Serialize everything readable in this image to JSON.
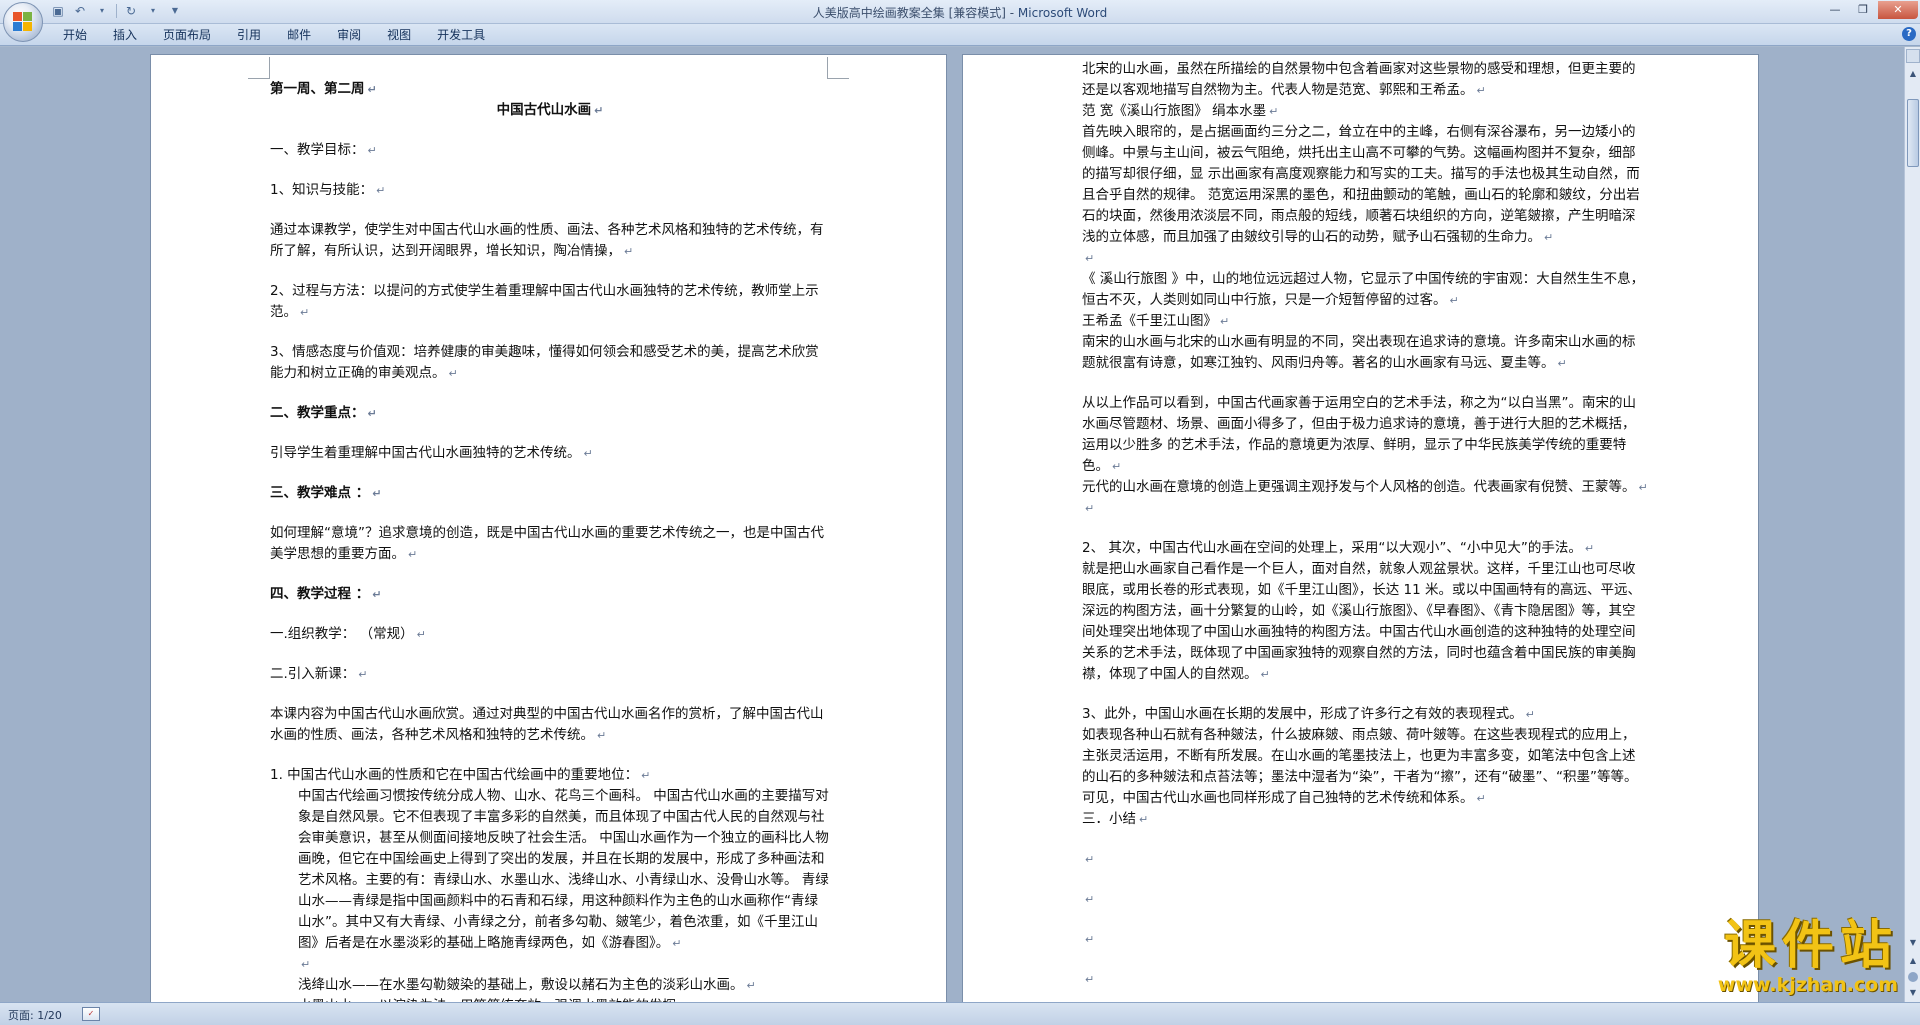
{
  "window": {
    "title_doc": "人美版高中绘画教案全集 [兼容模式] - ",
    "title_app": "Microsoft Word"
  },
  "ribbon": {
    "tabs": [
      "开始",
      "插入",
      "页面布局",
      "引用",
      "邮件",
      "审阅",
      "视图",
      "开发工具"
    ]
  },
  "status": {
    "page": "页面: 1/20"
  },
  "watermark": {
    "logo": "课件站",
    "url": "www.kjzhan.com"
  },
  "colors": {
    "accent": "#2a6ac4",
    "watermark": "#f2c315"
  },
  "left_page": [
    {
      "t": "第一周、第二周",
      "s": "b"
    },
    {
      "t": "中国古代山水画",
      "s": "b center"
    },
    {
      "t": "",
      "s": "gap"
    },
    {
      "t": "一、教学目标：",
      "s": ""
    },
    {
      "t": "",
      "s": "gap"
    },
    {
      "t": "1、知识与技能：",
      "s": ""
    },
    {
      "t": "",
      "s": "gap"
    },
    {
      "t": "通过本课教学，使学生对中国古代山水画的性质、画法、各种艺术风格和独特的艺术传统，有所了解，有所认识，达到开阔眼界，增长知识，陶冶情操，",
      "s": ""
    },
    {
      "t": "",
      "s": "gap"
    },
    {
      "t": "2、过程与方法：以提问的方式使学生着重理解中国古代山水画独特的艺术传统，教师堂上示范。",
      "s": ""
    },
    {
      "t": "",
      "s": "gap"
    },
    {
      "t": "3、情感态度与价值观：培养健康的审美趣味，懂得如何领会和感受艺术的美，提高艺术欣赏能力和树立正确的审美观点。",
      "s": ""
    },
    {
      "t": "",
      "s": "gap"
    },
    {
      "t": "二、教学重点：",
      "s": "b"
    },
    {
      "t": "",
      "s": "gap"
    },
    {
      "t": "引导学生着重理解中国古代山水画独特的艺术传统。",
      "s": ""
    },
    {
      "t": "",
      "s": "gap"
    },
    {
      "t": "三、教学难点 ：",
      "s": "b"
    },
    {
      "t": "",
      "s": "gap"
    },
    {
      "t": "如何理解“意境”？追求意境的创造，既是中国古代山水画的重要艺术传统之一，也是中国古代美学思想的重要方面。",
      "s": ""
    },
    {
      "t": "",
      "s": "gap"
    },
    {
      "t": "四、教学过程 ：",
      "s": "b"
    },
    {
      "t": "",
      "s": "gap"
    },
    {
      "t": "一.组织教学：  （常规）",
      "s": ""
    },
    {
      "t": "",
      "s": "gap"
    },
    {
      "t": "二.引入新课：",
      "s": ""
    },
    {
      "t": "",
      "s": "gap"
    },
    {
      "t": "本课内容为中国古代山水画欣赏。通过对典型的中国古代山水画名作的赏析，了解中国古代山水画的性质、画法，各种艺术风格和独特的艺术传统。",
      "s": ""
    },
    {
      "t": "",
      "s": "gap"
    },
    {
      "t": "1.  中国古代山水画的性质和它在中国古代绘画中的重要地位：",
      "s": ""
    },
    {
      "t": "中国古代绘画习惯按传统分成人物、山水、花鸟三个画科。 中国古代山水画的主要描写对象是自然风景。它不但表现了丰富多彩的自然美，而且体现了中国古代人民的自然观与社会审美意识，甚至从侧面间接地反映了社会生活。 中国山水画作为一个独立的画科比人物画晚，但它在中国绘画史上得到了突出的发展，并且在长期的发展中，形成了多种画法和艺术风格。主要的有：青绿山水、水墨山水、浅绛山水、小青绿山水、没骨山水等。 青绿山水——青绿是指中国画颜料中的石青和石绿，用这种颜料作为主色的山水画称作“青绿山水”。其中又有大青绿、小青绿之分，前者多勾勒、皴笔少，着色浓重，如《千里江山图》后者是在水墨淡彩的基础上略施青绿两色，如《游春图》。",
      "s": "indent"
    },
    {
      "t": "",
      "s": "indent"
    },
    {
      "t": "浅绛山水——在水墨勾勒皴染的基础上，敷设以赭石为主色的淡彩山水画。",
      "s": "indent"
    },
    {
      "t": "水墨山水——以渲染为法，用笔简练奔放，强调水墨效能的发挥。",
      "s": "indent"
    }
  ],
  "right_page": [
    {
      "t": "北宋的山水画，虽然在所描绘的自然景物中包含着画家对这些景物的感受和理想，但更主要的还是以客观地描写自然物为主。代表人物是范宽、郭熙和王希孟。",
      "s": ""
    },
    {
      "t": "范 宽《溪山行旅图》 绢本水墨",
      "s": ""
    },
    {
      "t": "首先映入眼帘的，是占据画面约三分之二，耸立在中的主峰，右侧有深谷瀑布，另一边矮小的侧峰。中景与主山间，被云气阻绝，烘托出主山高不可攀的气势。这幅画构图并不复杂，细部的描写却很仔细，显 示出画家有高度观察能力和写实的工夫。描写的手法也极其生动自然，而且合乎自然的规律。 范宽运用深黑的墨色，和扭曲颤动的笔触，画山石的轮廓和皴纹，分出岩石的块面，然後用浓淡层不同，雨点般的短线，顺著石块组织的方向，逆笔皴擦，产生明暗深浅的立体感，而且加强了由皴纹引导的山石的动势，赋予山石强韧的生命力。",
      "s": ""
    },
    {
      "t": "",
      "s": ""
    },
    {
      "t": "《 溪山行旅图 》中，山的地位远远超过人物，它显示了中国传统的宇宙观：大自然生生不息，恒古不灭，人类则如同山中行旅，只是一介短暂停留的过客。",
      "s": ""
    },
    {
      "t": "王希孟《千里江山图》",
      "s": ""
    },
    {
      "t": "南宋的山水画与北宋的山水画有明显的不同，突出表现在追求诗的意境。许多南宋山水画的标题就很富有诗意，如寒江独钓、风雨归舟等。著名的山水画家有马远、夏圭等。",
      "s": ""
    },
    {
      "t": "",
      "s": "gap"
    },
    {
      "t": "从以上作品可以看到，中国古代画家善于运用空白的艺术手法，称之为“以白当黑”。南宋的山水画尽管题材、场景、画面小得多了，但由于极力追求诗的意境，善于进行大胆的艺术概括，运用以少胜多 的艺术手法，作品的意境更为浓厚、鲜明，显示了中华民族美学传统的重要特色。",
      "s": ""
    },
    {
      "t": "元代的山水画在意境的创造上更强调主观抒发与个人风格的创造。代表画家有倪赞、王蒙等。",
      "s": ""
    },
    {
      "t": "",
      "s": ""
    },
    {
      "t": "",
      "s": "gap"
    },
    {
      "t": "2、 其次，中国古代山水画在空间的处理上，采用“以大观小”、“小中见大”的手法。",
      "s": ""
    },
    {
      "t": "就是把山水画家自己看作是一个巨人，面对自然，就象人观盆景状。这样，千里江山也可尽收眼底，或用长卷的形式表现，如《千里江山图》，长达 11 米。或以中国画特有的高远、平远、深远的构图方法，画十分繁复的山岭，如《溪山行旅图》、《早春图》、《青卞隐居图》等，其空间处理突出地体现了中国山水画独特的构图方法。中国古代山水画创造的这种独特的处理空间关系的艺术手法，既体现了中国画家独特的观察自然的方法，同时也蕴含着中国民族的审美胸襟，体现了中国人的自然观。",
      "s": ""
    },
    {
      "t": "",
      "s": "gap"
    },
    {
      "t": "3、此外，中国山水画在长期的发展中，形成了许多行之有效的表现程式。",
      "s": ""
    },
    {
      "t": "如表现各种山石就有各种皴法，什么披麻皴、雨点皴、荷叶皴等。在这些表现程式的应用上，主张灵活运用，不断有所发展。在山水画的笔墨技法上，也更为丰富多变，如笔法中包含上述的山石的多种皴法和点苔法等；墨法中湿者为“染”，干者为“擦”，还有“破墨”、“积墨”等等。可见，中国古代山水画也同样形成了自己独特的艺术传统和体系。",
      "s": ""
    },
    {
      "t": " 三．小结",
      "s": ""
    },
    {
      "t": "",
      "s": "gap"
    },
    {
      "t": "",
      "s": ""
    },
    {
      "t": "",
      "s": "gap"
    },
    {
      "t": "",
      "s": ""
    },
    {
      "t": "",
      "s": "gap"
    },
    {
      "t": "",
      "s": ""
    },
    {
      "t": "",
      "s": "gap"
    },
    {
      "t": "",
      "s": ""
    }
  ]
}
